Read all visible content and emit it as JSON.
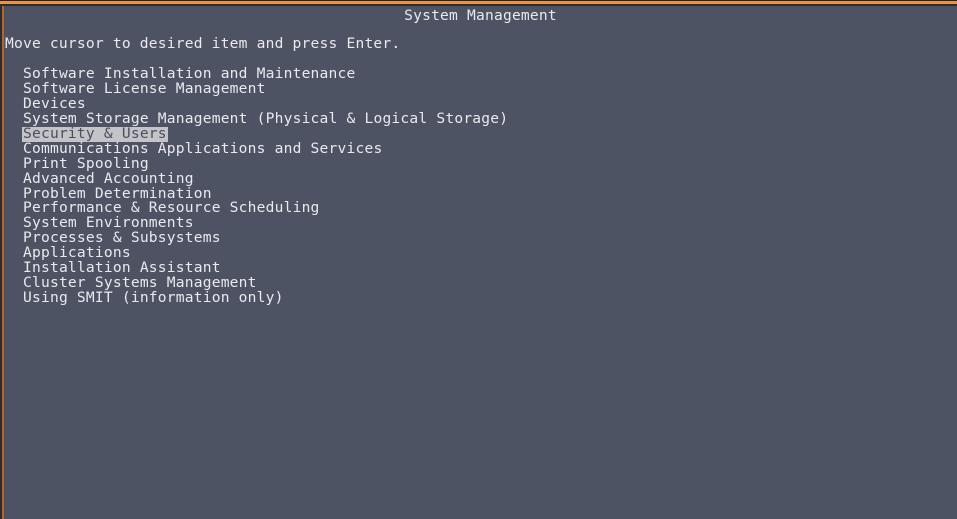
{
  "screen": {
    "title": "System Management",
    "instruction": "Move cursor to desired item and press Enter.",
    "background_color": "#4e5363",
    "text_color": "#e9e9ef",
    "accent_color": "#e8954a",
    "selection_background": "#c3c3c8",
    "selection_text_color": "#4a4f5e"
  },
  "menu": {
    "selected_index": 4,
    "items": [
      {
        "label": "Software Installation and Maintenance"
      },
      {
        "label": "Software License Management"
      },
      {
        "label": "Devices"
      },
      {
        "label": "System Storage Management (Physical & Logical Storage)"
      },
      {
        "label": "Security & Users"
      },
      {
        "label": "Communications Applications and Services"
      },
      {
        "label": "Print Spooling"
      },
      {
        "label": "Advanced Accounting"
      },
      {
        "label": "Problem Determination"
      },
      {
        "label": "Performance & Resource Scheduling"
      },
      {
        "label": "System Environments"
      },
      {
        "label": "Processes & Subsystems"
      },
      {
        "label": "Applications"
      },
      {
        "label": "Installation Assistant"
      },
      {
        "label": "Cluster Systems Management"
      },
      {
        "label": "Using SMIT (information only)"
      }
    ]
  }
}
